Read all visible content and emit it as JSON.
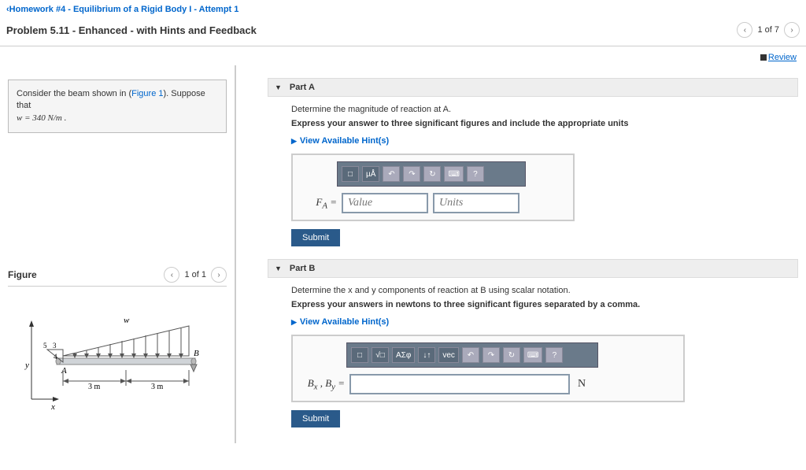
{
  "nav": {
    "back_label": "Homework #4 - Equilibrium of a Rigid Body I - Attempt 1"
  },
  "title": "Problem 5.11 - Enhanced - with Hints and Feedback",
  "page_nav": {
    "current": "1 of 7"
  },
  "review_label": "Review",
  "prompt": {
    "pre": "Consider the beam shown in (",
    "figlink": "Figure 1",
    "post": "). Suppose that ",
    "eq": "w = 340  N/m ."
  },
  "figure": {
    "header": "Figure",
    "count": "1 of 1",
    "labels": {
      "w": "w",
      "A": "A",
      "B": "B",
      "y": "y",
      "x": "x",
      "d1": "3 m",
      "d2": "3 m",
      "t3": "3",
      "t4": "4",
      "t5": "5"
    }
  },
  "partA": {
    "title": "Part A",
    "desc": "Determine the magnitude of reaction at A.",
    "instr": "Express your answer to three significant figures and include the appropriate units",
    "hint": "View Available Hint(s)",
    "label": "F_A =",
    "value_ph": "Value",
    "units_ph": "Units",
    "tb": {
      "b1": "□",
      "b2": "µÅ",
      "b3": "↶",
      "b4": "↷",
      "b5": "↻",
      "b6": "⌨",
      "b7": "?"
    },
    "submit": "Submit"
  },
  "partB": {
    "title": "Part B",
    "desc": "Determine the x and y components of reaction at B using scalar notation.",
    "instr": "Express your answers in newtons to three significant figures separated by a comma.",
    "hint": "View Available Hint(s)",
    "label": "B_x , B_y =",
    "unit": "N",
    "tb": {
      "b1": "□",
      "b2": "√□",
      "b3": "ΑΣφ",
      "b4": "↓↑",
      "b5": "vec",
      "b6": "↶",
      "b7": "↷",
      "b8": "↻",
      "b9": "⌨",
      "b10": "?"
    },
    "submit": "Submit"
  }
}
